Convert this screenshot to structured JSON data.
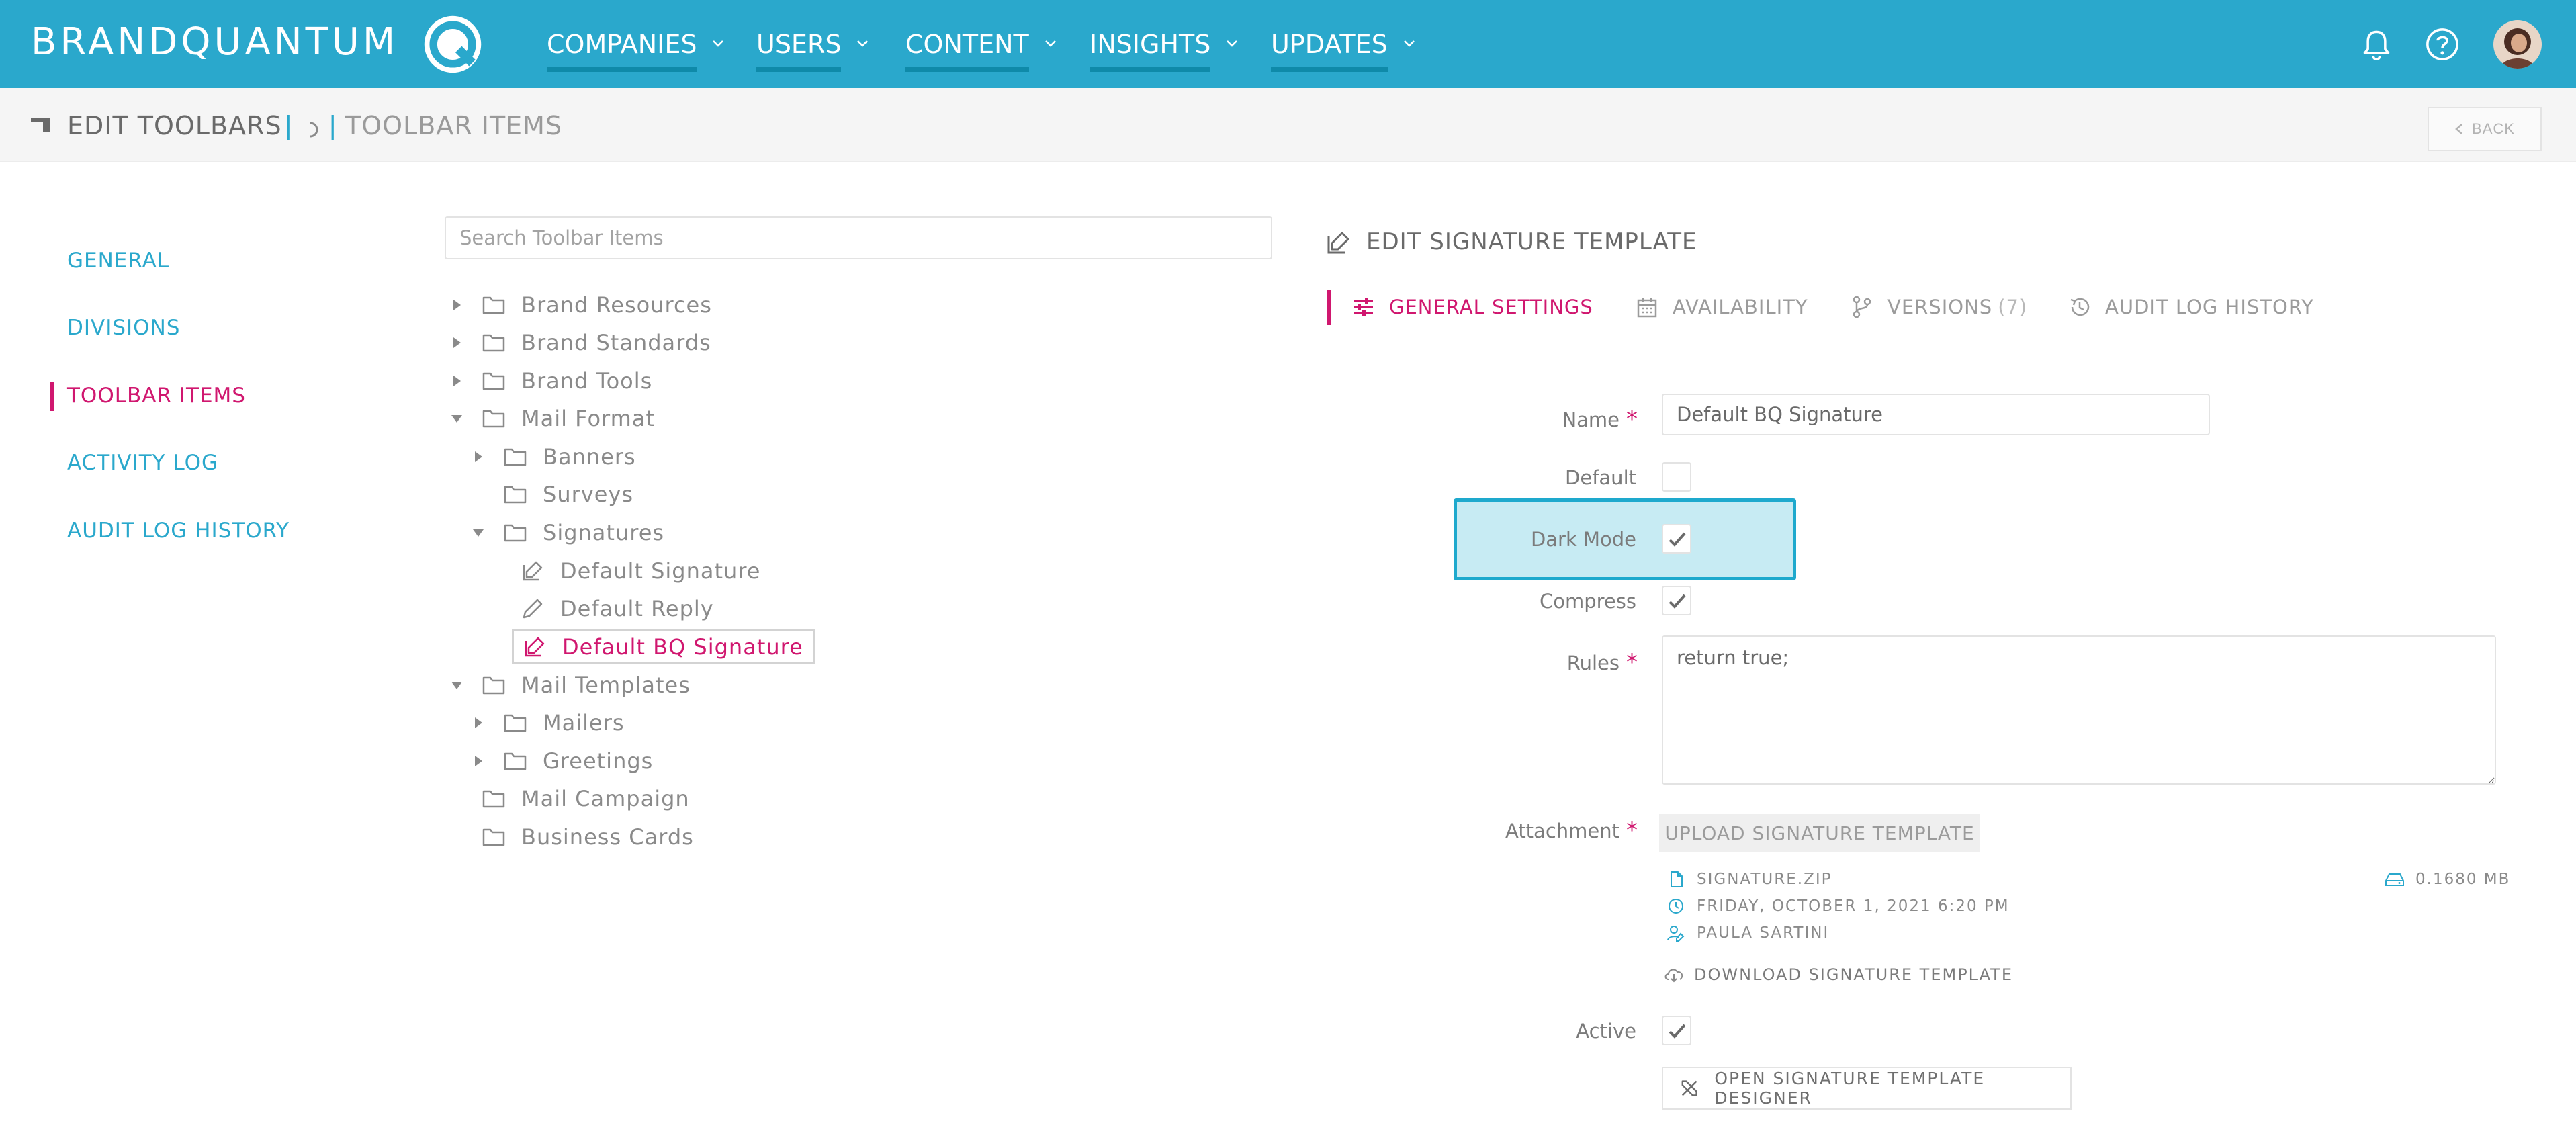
{
  "app": {
    "brand": "BRANDQUANTUM"
  },
  "nav": {
    "items": [
      {
        "label": "COMPANIES"
      },
      {
        "label": "USERS"
      },
      {
        "label": "CONTENT"
      },
      {
        "label": "INSIGHTS"
      },
      {
        "label": "UPDATES"
      }
    ]
  },
  "header": {
    "title": "EDIT TOOLBARS",
    "separator": "|",
    "subtitle": "TOOLBAR ITEMS",
    "back_label": "BACK"
  },
  "sidebar": {
    "items": [
      {
        "label": "GENERAL"
      },
      {
        "label": "DIVISIONS"
      },
      {
        "label": "TOOLBAR ITEMS"
      },
      {
        "label": "ACTIVITY LOG"
      },
      {
        "label": "AUDIT LOG HISTORY"
      }
    ]
  },
  "tree": {
    "search_placeholder": "Search Toolbar Items",
    "nodes": [
      {
        "label": "Brand Resources"
      },
      {
        "label": "Brand Standards"
      },
      {
        "label": "Brand Tools"
      },
      {
        "label": "Mail Format"
      },
      {
        "label": "Banners"
      },
      {
        "label": "Surveys"
      },
      {
        "label": "Signatures"
      },
      {
        "label": "Default Signature"
      },
      {
        "label": "Default Reply"
      },
      {
        "label": "Default BQ Signature"
      },
      {
        "label": "Mail Templates"
      },
      {
        "label": "Mailers"
      },
      {
        "label": "Greetings"
      },
      {
        "label": "Mail Campaign"
      },
      {
        "label": "Business Cards"
      }
    ]
  },
  "panel": {
    "title": "EDIT SIGNATURE TEMPLATE",
    "tabs": [
      {
        "label": "GENERAL SETTINGS"
      },
      {
        "label": "AVAILABILITY"
      },
      {
        "label": "VERSIONS",
        "count": "(7)"
      },
      {
        "label": "AUDIT LOG HISTORY"
      }
    ],
    "form": {
      "name_label": "Name",
      "name_value": "Default BQ Signature",
      "default_label": "Default",
      "default_checked": false,
      "dark_mode_label": "Dark Mode",
      "dark_mode_checked": true,
      "compress_label": "Compress",
      "compress_checked": true,
      "rules_label": "Rules",
      "rules_value": "return true;",
      "attachment_label": "Attachment",
      "upload_label": "UPLOAD SIGNATURE TEMPLATE",
      "file_name": "SIGNATURE.ZIP",
      "file_date": "FRIDAY, OCTOBER 1, 2021 6:20 PM",
      "file_author": "PAULA SARTINI",
      "file_size": "0.1680 MB",
      "download_label": "DOWNLOAD SIGNATURE TEMPLATE",
      "active_label": "Active",
      "active_checked": true,
      "designer_label": "OPEN SIGNATURE TEMPLATE DESIGNER",
      "required_mark": "*"
    }
  },
  "colors": {
    "nav_bg": "#2aa8cc",
    "accent": "#d0176f",
    "link": "#2aa8cc",
    "highlight": "#c7ebf3"
  }
}
